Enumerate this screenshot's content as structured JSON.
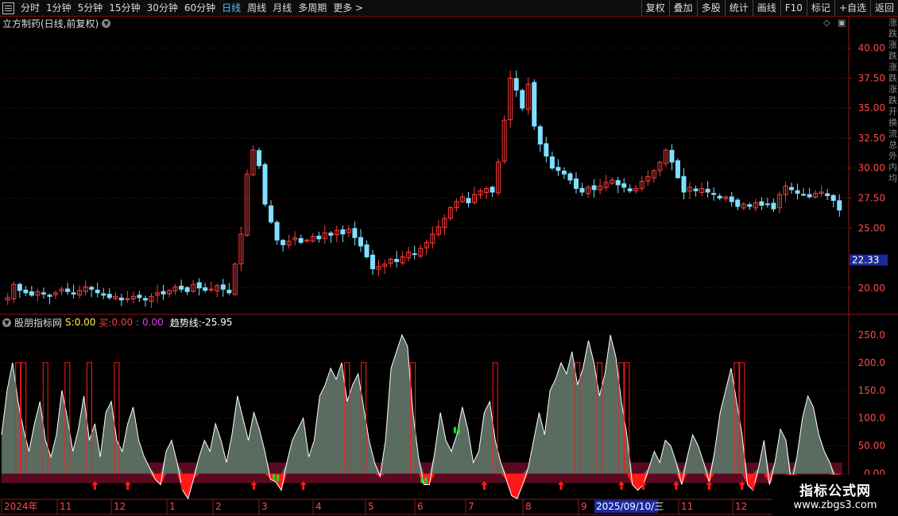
{
  "toolbar": {
    "periods": [
      "分时",
      "1分钟",
      "5分钟",
      "15分钟",
      "30分钟",
      "60分钟",
      "日线",
      "周线",
      "月线",
      "多周期",
      "更多 >"
    ],
    "active_period": "日线",
    "right_buttons": [
      "复权",
      "叠加",
      "多股",
      "统计",
      "画线",
      "F10",
      "标记",
      "+自选",
      "返回"
    ]
  },
  "main_header": {
    "stock": "立方制药(日线,前复权)"
  },
  "indicator_header": {
    "name": "股朋指标网",
    "s_label": "S:",
    "s_value": "0.00",
    "buy_label": "买:",
    "buy_value": "0.00",
    "buy_value2": ": 0.00",
    "trend_label": "趋势线:",
    "trend_value": "-25.95"
  },
  "price_axis": {
    "ticks": [
      "40.00",
      "37.50",
      "35.00",
      "32.50",
      "30.00",
      "27.50",
      "25.00",
      "20.00"
    ],
    "current_price": "22.33"
  },
  "indicator_axis": {
    "ticks": [
      "250.0",
      "200.0",
      "150.0",
      "100.0",
      "50.00",
      "0.00"
    ]
  },
  "time_axis": {
    "labels": [
      "2024年",
      "11",
      "12",
      "1",
      "2",
      "3",
      "4",
      "5",
      "6",
      "7",
      "8",
      "9",
      "11",
      "12"
    ],
    "cursor_date": "2025/09/10/三"
  },
  "side_text": [
    "涨",
    "跌",
    "涨",
    "跌",
    "涨",
    "跌",
    "涨",
    "跌",
    "开",
    "换",
    "流",
    "总",
    "外",
    "内",
    "均"
  ],
  "watermark": {
    "name": "指标公式网",
    "url": "www.zbgs3.com"
  },
  "colors": {
    "up": "#ff3a3a",
    "down": "#7fe0ff",
    "accent": "#4fc3ff",
    "grid": "#8a1a1a",
    "area": "#5a6b60",
    "band": "#5a0a20",
    "sell": "#ff1a1a",
    "signal_green": "#22dd22"
  },
  "chart_data": [
    {
      "type": "candlestick",
      "title": "立方制药(日线,前复权)",
      "ylim": [
        18.0,
        41.5
      ],
      "close_series": [
        19.2,
        20.3,
        19.8,
        19.6,
        19.4,
        19.7,
        19.5,
        19.3,
        19.6,
        19.9,
        19.7,
        19.5,
        19.8,
        20.1,
        19.9,
        19.6,
        19.4,
        19.2,
        19.3,
        19.0,
        19.1,
        19.3,
        19.2,
        19.0,
        19.3,
        19.6,
        19.5,
        19.8,
        20.1,
        19.9,
        19.7,
        20.3,
        20.0,
        19.8,
        19.9,
        20.2,
        19.9,
        19.6,
        22.0,
        24.5,
        29.5,
        31.5,
        30.2,
        27.0,
        25.5,
        24.0,
        23.6,
        23.9,
        24.2,
        23.8,
        24.0,
        24.3,
        24.1,
        24.6,
        24.4,
        24.8,
        24.5,
        24.9,
        24.2,
        23.5,
        22.6,
        21.6,
        21.8,
        22.0,
        22.4,
        22.2,
        22.6,
        23.0,
        22.8,
        23.3,
        23.8,
        24.5,
        25.1,
        25.8,
        26.7,
        27.2,
        27.6,
        27.1,
        27.8,
        28.1,
        28.3,
        28.0,
        30.5,
        34.0,
        37.5,
        36.5,
        35.0,
        37.0,
        33.5,
        32.0,
        31.0,
        30.0,
        29.8,
        29.5,
        29.0,
        28.3,
        28.0,
        28.4,
        28.2,
        28.5,
        28.8,
        29.0,
        28.6,
        28.4,
        28.1,
        28.3,
        28.9,
        29.3,
        29.8,
        30.5,
        31.5,
        30.5,
        29.2,
        28.0,
        28.4,
        28.1,
        28.3,
        28.0,
        27.8,
        27.5,
        27.6,
        27.2,
        26.8,
        27.0,
        26.8,
        27.1,
        26.9,
        27.0,
        26.6,
        27.8,
        28.5,
        28.2,
        27.9,
        27.8,
        27.6,
        27.9,
        28.0,
        27.7,
        27.3,
        26.5
      ]
    },
    {
      "type": "area",
      "title": "股朋指标网",
      "ylim": [
        -45,
        260
      ],
      "values": [
        70,
        150,
        200,
        130,
        80,
        40,
        90,
        130,
        60,
        30,
        70,
        150,
        100,
        40,
        80,
        140,
        60,
        90,
        30,
        110,
        130,
        60,
        40,
        90,
        120,
        60,
        30,
        10,
        -10,
        -20,
        40,
        60,
        20,
        -30,
        -45,
        -10,
        30,
        60,
        40,
        90,
        60,
        20,
        70,
        140,
        100,
        60,
        110,
        80,
        40,
        -10,
        -15,
        -30,
        20,
        60,
        80,
        100,
        30,
        60,
        140,
        160,
        190,
        170,
        200,
        130,
        160,
        180,
        120,
        60,
        20,
        -5,
        60,
        190,
        220,
        250,
        230,
        110,
        30,
        -20,
        -20,
        40,
        110,
        60,
        40,
        70,
        120,
        80,
        20,
        40,
        110,
        130,
        60,
        20,
        -10,
        -40,
        -45,
        -20,
        10,
        60,
        110,
        70,
        150,
        170,
        200,
        180,
        220,
        160,
        190,
        240,
        200,
        140,
        180,
        250,
        210,
        130,
        70,
        -20,
        -30,
        -20,
        10,
        40,
        20,
        60,
        50,
        20,
        -20,
        30,
        70,
        50,
        20,
        -15,
        40,
        110,
        150,
        190,
        130,
        70,
        -20,
        -30,
        10,
        60,
        -20,
        20,
        80,
        60,
        -20,
        30,
        100,
        140,
        120,
        70,
        40,
        20,
        -10,
        -25
      ],
      "buy_markers": [
        17,
        23,
        33,
        46,
        55,
        88,
        102,
        113,
        117,
        123,
        129,
        135,
        137
      ],
      "top_markers": [
        50,
        77,
        83
      ]
    }
  ]
}
